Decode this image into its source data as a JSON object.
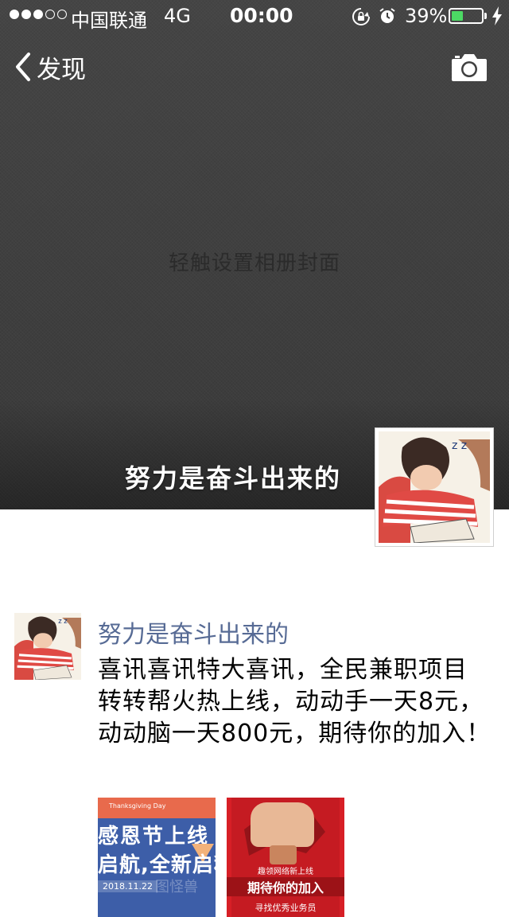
{
  "status_bar": {
    "carrier": "中国联通",
    "network": "4G",
    "time": "00:00",
    "battery_percent_text": "39%",
    "battery_level": 0.39,
    "signal_bars_filled": 3,
    "signal_bars_total": 5,
    "icons": [
      "orientation-lock-icon",
      "alarm-icon",
      "battery-icon",
      "charging-bolt-icon"
    ]
  },
  "nav": {
    "back_label": "发现",
    "camera_icon": "camera-icon"
  },
  "cover": {
    "hint": "轻触设置相册封面",
    "background_color": "#3f3f3f"
  },
  "profile": {
    "name": "努力是奋斗出来的"
  },
  "post": {
    "author": "努力是奋斗出来的",
    "text": "喜讯喜讯特大喜讯，全民兼职项目转转帮火热上线，动动手一天8元，动动脑一天800元，期待你的加入！",
    "images": [
      {
        "line1": "感恩节上线",
        "line2": "启航,全新启程",
        "tiny": "Thanksgiving Day",
        "date": "2018.11.22",
        "watermark": "图怪兽"
      },
      {
        "t1": "趣领网络新上线",
        "t2": "期待你的加入",
        "t3": "寻找优秀业务员"
      }
    ]
  },
  "colors": {
    "link": "#576b95",
    "battery_green": "#4cd964"
  }
}
